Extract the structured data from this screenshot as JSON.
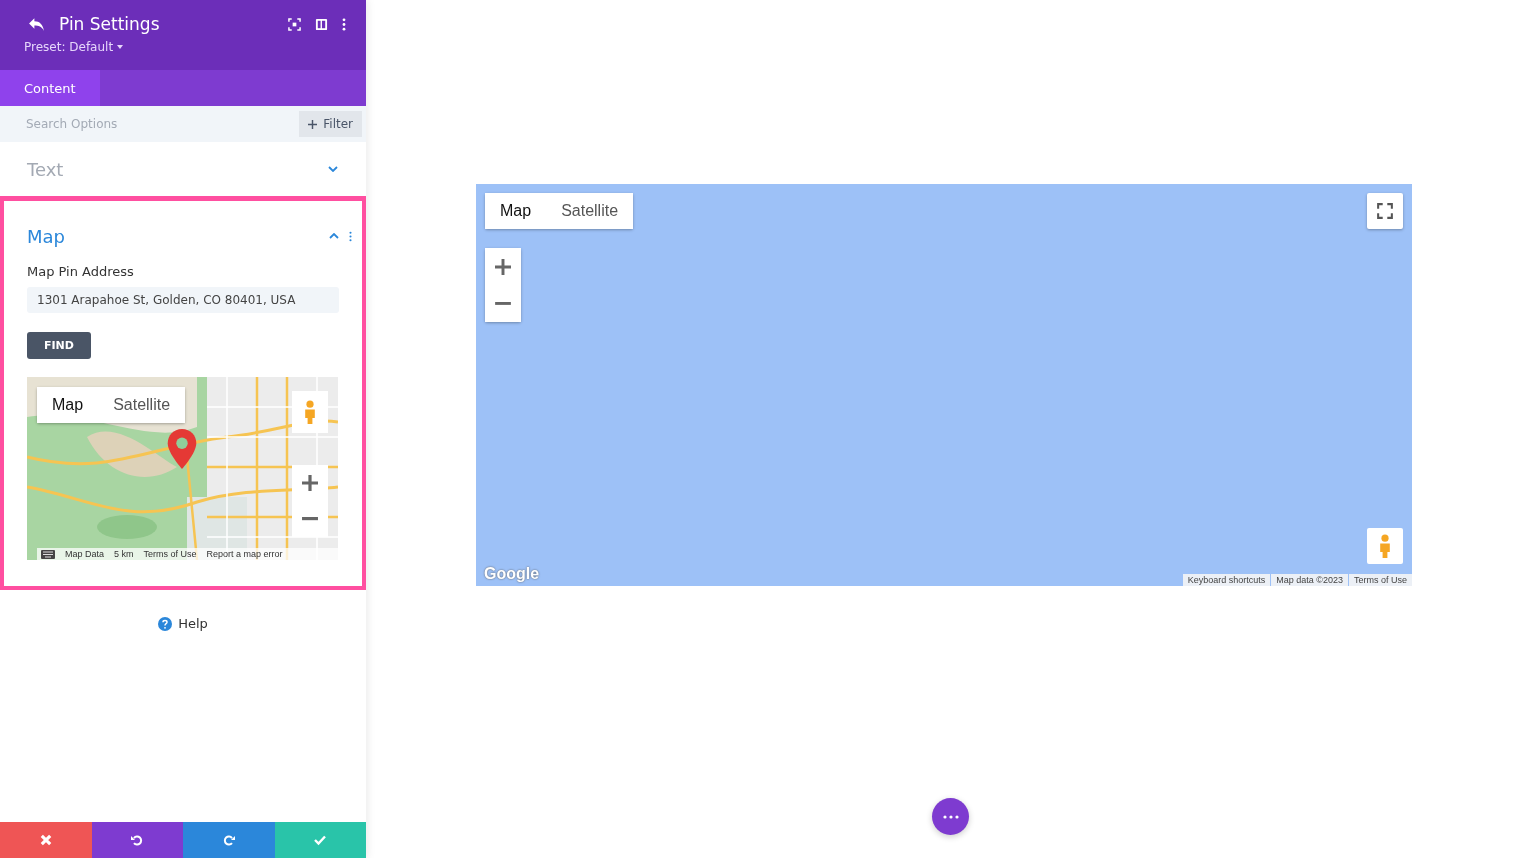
{
  "header": {
    "title": "Pin Settings",
    "preset": "Preset: Default"
  },
  "tabs": [
    {
      "label": "Content",
      "selected": true
    }
  ],
  "search": {
    "placeholder": "Search Options",
    "filter_button": "Filter"
  },
  "sections": [
    {
      "title": "Text",
      "expanded": false,
      "highlighted": false
    },
    {
      "title": "Map",
      "expanded": true,
      "highlighted": true
    }
  ],
  "map_settings": {
    "label": "Map Pin Address",
    "value": "1301 Arapahoe St, Golden, CO 80401, USA",
    "button": "FIND",
    "preview": {
      "types": [
        {
          "label": "Map",
          "selected": true
        },
        {
          "label": "Satellite",
          "selected": false
        }
      ],
      "footer": [
        "Map Data",
        "5 km",
        "Terms of Use",
        "Report a map error"
      ]
    }
  },
  "help": "Help",
  "map": {
    "types": [
      {
        "label": "Map",
        "selected": true
      },
      {
        "label": "Satellite",
        "selected": false
      }
    ],
    "logo": "Google",
    "footer": [
      "Keyboard shortcuts",
      "Map data ©2023",
      "Terms of Use"
    ]
  }
}
